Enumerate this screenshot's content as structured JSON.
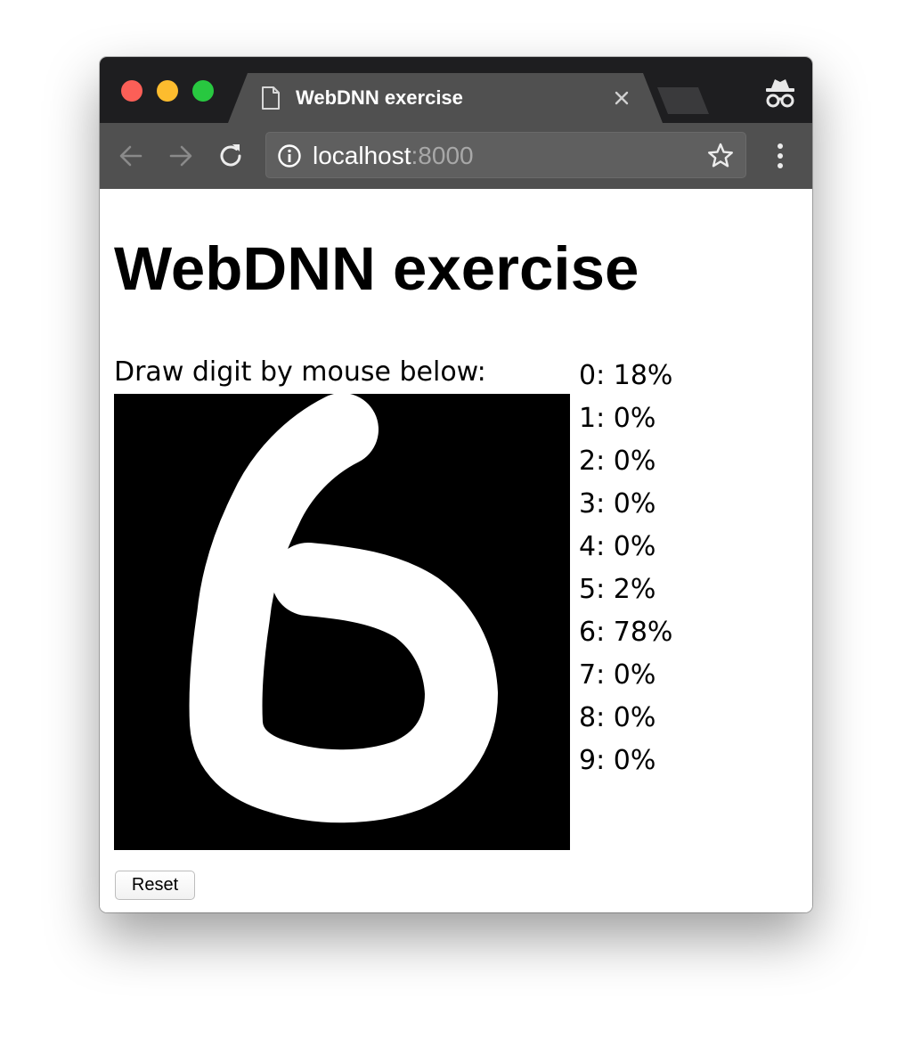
{
  "browser": {
    "tab": {
      "title": "WebDNN exercise",
      "page_icon": "document-icon",
      "close_icon": "close-icon"
    },
    "address_bar": {
      "host": "localhost",
      "port": ":8000",
      "site_info_icon": "info-icon",
      "bookmark_icon": "star-icon"
    },
    "nav": {
      "back_icon": "arrow-left-icon",
      "forward_icon": "arrow-right-icon",
      "reload_icon": "reload-icon",
      "menu_icon": "vertical-dots-icon"
    },
    "incognito_icon": "incognito-icon",
    "traffic_colors": {
      "close": "#fc5f57",
      "minimize": "#fdbc2e",
      "zoom": "#28c840"
    }
  },
  "page": {
    "heading": "WebDNN exercise",
    "instructions": "Draw digit by mouse below:",
    "canvas": {
      "background": "#000000",
      "stroke": "#ffffff",
      "drawn_digit": "6"
    },
    "results": [
      {
        "label": "0: 18%"
      },
      {
        "label": "1: 0%"
      },
      {
        "label": "2: 0%"
      },
      {
        "label": "3: 0%"
      },
      {
        "label": "4: 0%"
      },
      {
        "label": "5: 2%"
      },
      {
        "label": "6: 78%"
      },
      {
        "label": "7: 0%"
      },
      {
        "label": "8: 0%"
      },
      {
        "label": "9: 0%"
      }
    ],
    "reset_label": "Reset"
  }
}
